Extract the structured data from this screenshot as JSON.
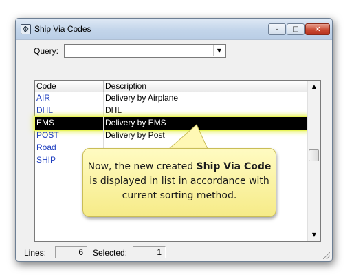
{
  "window": {
    "title": "Ship Via Codes"
  },
  "title_buttons": {
    "minimize": "–",
    "maximize": "□",
    "close": "✕"
  },
  "query": {
    "label": "Query:",
    "value": ""
  },
  "table": {
    "columns": [
      "Code",
      "Description"
    ],
    "rows": [
      {
        "code": "AIR",
        "description": "Delivery by Airplane"
      },
      {
        "code": "DHL",
        "description": "DHL"
      },
      {
        "code": "EMS",
        "description": "Delivery by EMS"
      },
      {
        "code": "POST",
        "description": "Delivery by Post"
      },
      {
        "code": "Road",
        "description": ""
      },
      {
        "code": "SHIP",
        "description": ""
      }
    ],
    "selected_row": 2
  },
  "callout": {
    "text_before": "Now, the new created ",
    "text_bold": "Ship Via Code",
    "text_after": " is displayed in list in accordance with current sorting method."
  },
  "status": {
    "lines_label": "Lines:",
    "lines_value": "6",
    "selected_label": "Selected:",
    "selected_value": "1"
  },
  "colors": {
    "highlight_glow": "#e9f55a",
    "code_text": "#1f3fbf",
    "callout_fill": "#fffbc2"
  },
  "icons": {
    "app": "ship-via-app-icon",
    "dropdown": "chevron-down-icon",
    "scroll_up": "arrow-up-icon",
    "scroll_down": "arrow-down-icon"
  }
}
